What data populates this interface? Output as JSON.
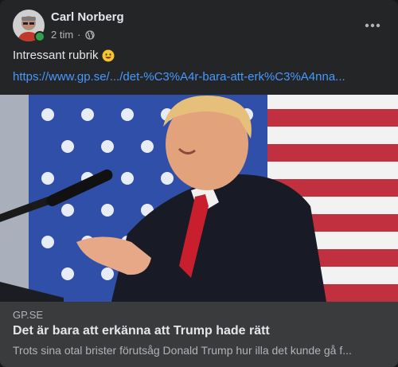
{
  "post": {
    "author": "Carl Norberg",
    "time": "2 tim",
    "separator": "·",
    "privacy_icon": "globe-icon",
    "more_icon": "more-options-icon",
    "text": "Intressant rubrik",
    "emoji": "smiling-face-icon",
    "link": "https://www.gp.se/.../det-%C3%A4r-bara-att-erk%C3%A4nna...",
    "image_subject": "photo of Donald Trump speaking at a microphone in front of an American flag"
  },
  "preview": {
    "domain": "GP.SE",
    "headline": "Det är bara att erkänna att Trump hade rätt",
    "description": "Trots sina otal brister förutsåg Donald Trump hur illa det kunde gå f..."
  },
  "colors": {
    "card_bg": "#242526",
    "preview_bg": "#3a3b3c",
    "link": "#4599ff",
    "online": "#31a24c"
  }
}
